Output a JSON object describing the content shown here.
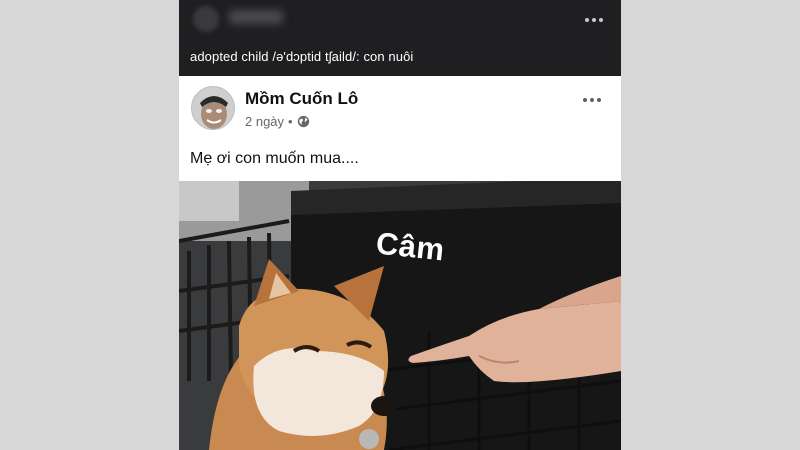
{
  "caption": {
    "text": "adopted child /ə'dɔptid tʃaild/: con nuôi"
  },
  "post": {
    "author": "Mồm Cuốn Lô",
    "time": "2 ngày",
    "separator": "•",
    "text": "Mẹ ơi con muốn mua....",
    "image_sign_text": "Câm"
  },
  "icons": {
    "post_menu": "more-horizontal-icon",
    "privacy": "globe-icon"
  },
  "colors": {
    "header_bg": "#1f1f21",
    "card_bg": "#ffffff",
    "meta_text": "#65676b"
  }
}
